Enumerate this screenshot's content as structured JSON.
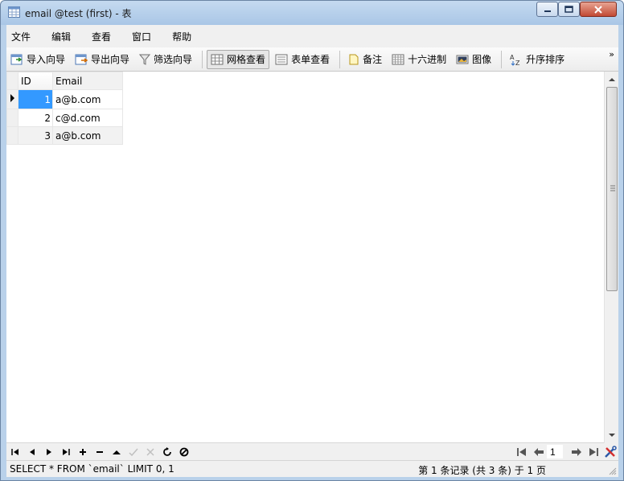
{
  "window": {
    "title": "email @test (first) - 表"
  },
  "menu": [
    "文件",
    "编辑",
    "查看",
    "窗口",
    "帮助"
  ],
  "toolbar": {
    "import_wizard": "导入向导",
    "export_wizard": "导出向导",
    "filter_wizard": "筛选向导",
    "grid_view": "网格查看",
    "form_view": "表单查看",
    "memo": "备注",
    "hex": "十六进制",
    "image": "图像",
    "sort_asc": "升序排序",
    "more": "»"
  },
  "grid": {
    "columns": [
      "ID",
      "Email"
    ],
    "rows": [
      {
        "id": "1",
        "email": "a@b.com",
        "selected": true
      },
      {
        "id": "2",
        "email": "c@d.com",
        "selected": false
      },
      {
        "id": "3",
        "email": "a@b.com",
        "selected": false
      }
    ]
  },
  "pager": {
    "page": "1"
  },
  "status": {
    "sql": "SELECT * FROM `email` LIMIT 0, 1",
    "record_info": "第 1 条记录 (共 3 条) 于 1 页"
  }
}
